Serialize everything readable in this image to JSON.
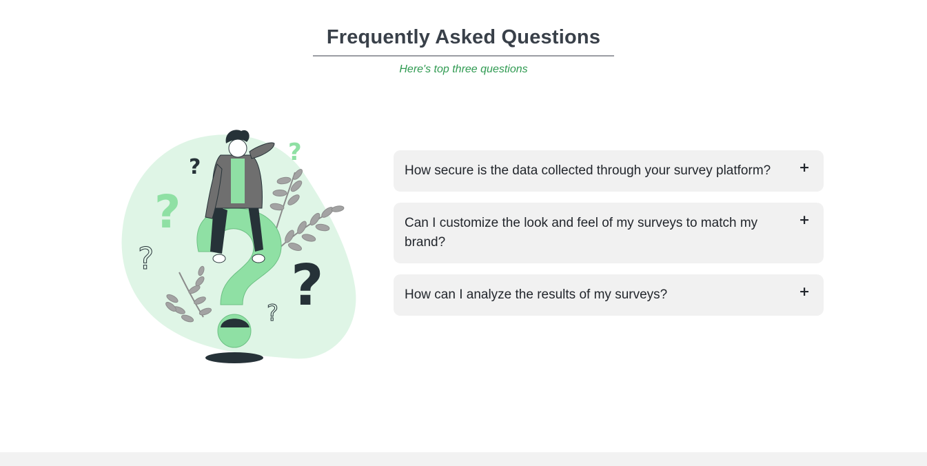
{
  "faq": {
    "title": "Frequently Asked Questions",
    "subtitle": "Here's top three questions",
    "items": [
      {
        "question": "How secure is the data collected through your survey platform?",
        "toggle": "+"
      },
      {
        "question": "Can I customize the look and feel of my surveys to match my brand?",
        "toggle": "+"
      },
      {
        "question": "How can I analyze the results of my surveys?",
        "toggle": "+"
      }
    ]
  },
  "illustration": {
    "icon": "confused-person-question-mark-illustration",
    "marks": [
      "?",
      "?",
      "?",
      "?",
      "?",
      "?"
    ]
  },
  "colors": {
    "accent_green": "#2f9a51",
    "light_green": "#8fe0a4",
    "blob_green": "#dff5e6",
    "dark": "#22262c",
    "card_bg": "#f1f1f1"
  }
}
